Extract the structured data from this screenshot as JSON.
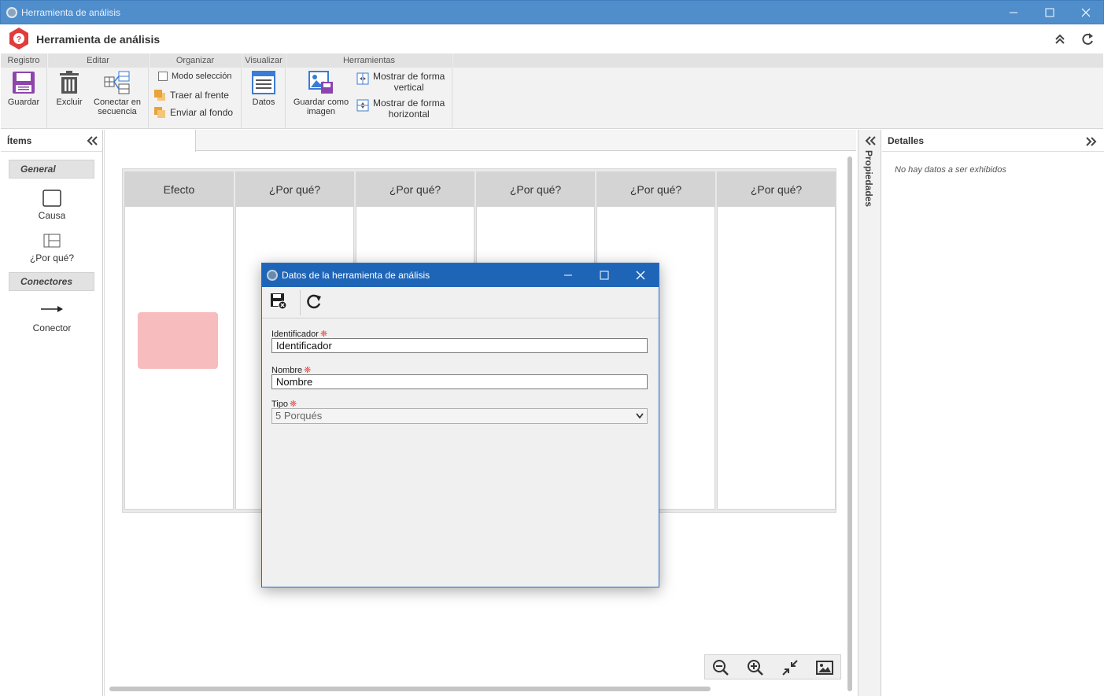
{
  "window": {
    "title": "Herramienta de análisis"
  },
  "app": {
    "title": "Herramienta de análisis"
  },
  "ribbon": {
    "groups": {
      "registro": "Registro",
      "editar": "Editar",
      "organizar": "Organizar",
      "visualizar": "Visualizar",
      "herramientas": "Herramientas"
    },
    "buttons": {
      "guardar": "Guardar",
      "excluir": "Excluir",
      "conectar_line1": "Conectar en",
      "conectar_line2": "secuencia",
      "modo_seleccion": "Modo selección",
      "traer_al_frente": "Traer al frente",
      "enviar_al_fondo": "Enviar al fondo",
      "datos": "Datos",
      "guardar_imagen_line1": "Guardar como",
      "guardar_imagen_line2": "imagen",
      "mostrar_vertical_line1": "Mostrar de forma",
      "mostrar_vertical_line2": "vertical",
      "mostrar_horizontal_line1": "Mostrar de forma",
      "mostrar_horizontal_line2": "horizontal"
    }
  },
  "left_panel": {
    "title": "Ítems",
    "sections": {
      "general": "General",
      "conectores": "Conectores"
    },
    "items": {
      "causa": "Causa",
      "por_que": "¿Por qué?",
      "conector": "Conector"
    }
  },
  "canvas": {
    "columns": [
      "Efecto",
      "¿Por qué?",
      "¿Por qué?",
      "¿Por qué?",
      "¿Por qué?",
      "¿Por qué?"
    ]
  },
  "properties_strip": {
    "label": "Propiedades"
  },
  "details": {
    "title": "Detalles",
    "empty": "No hay datos a ser exhibidos"
  },
  "dialog": {
    "title": "Datos de la herramienta de análisis",
    "fields": {
      "identificador": {
        "label": "Identificador",
        "value": "Identificador"
      },
      "nombre": {
        "label": "Nombre",
        "value": "Nombre"
      },
      "tipo": {
        "label": "Tipo",
        "value": "5 Porqués"
      }
    }
  },
  "colors": {
    "titlebar": "#4f8ecb",
    "dialog_titlebar": "#1f65b7",
    "effect_box": "#f7bcbd",
    "app_logo": "#e03c3c",
    "ribbon_bg": "#f2f2f2"
  }
}
